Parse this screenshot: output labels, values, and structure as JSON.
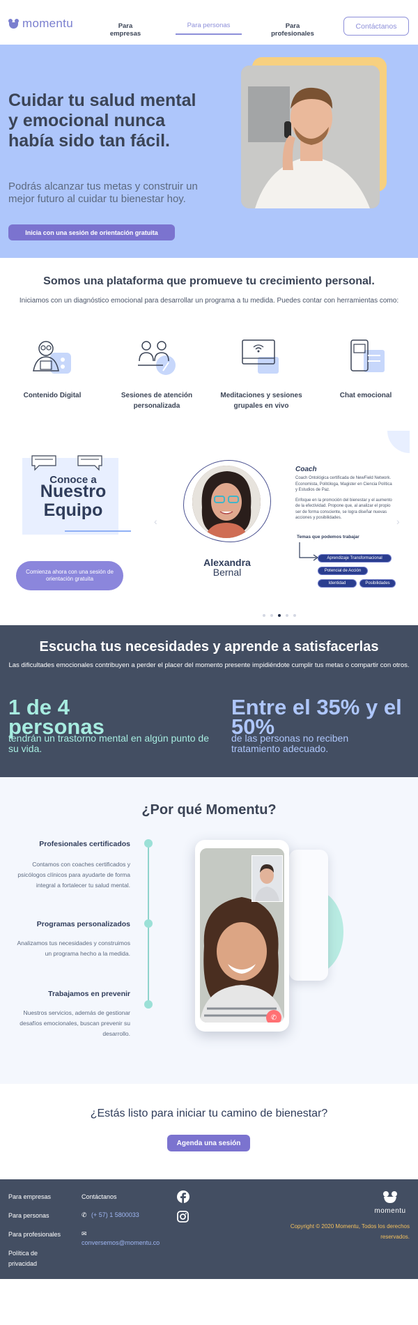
{
  "nav": {
    "logo_text": "momentu",
    "links": [
      {
        "line1": "Para",
        "line2": "empresas"
      },
      {
        "line1": "Para personas",
        "line2": ""
      },
      {
        "line1": "Para",
        "line2": "profesionales"
      }
    ],
    "contact_label": "Contáctanos"
  },
  "hero": {
    "title": "Cuidar tu salud mental y emocional nunca había sido tan fácil.",
    "subtitle": "Podrás alcanzar tus metas y construir un mejor futuro al cuidar tu bienestar hoy.",
    "button_label": "Inicia con una sesión de orientación gratuita"
  },
  "platform": {
    "title": "Somos una plataforma que promueve tu crecimiento personal.",
    "text": "Iniciamos con un diagnóstico emocional para desarrollar un programa a tu medida. Puedes contar con herramientas como:",
    "features": [
      {
        "label": "Contenido Digital",
        "icon": "digital-content-icon"
      },
      {
        "label": "Sesiones de atención personalizada",
        "icon": "personal-session-icon"
      },
      {
        "label": "Meditaciones y sesiones grupales en vivo",
        "icon": "live-meditation-icon"
      },
      {
        "label": "Chat emocional",
        "icon": "chat-icon"
      }
    ]
  },
  "team": {
    "conoce_line1": "Conoce a",
    "conoce_line2": "Nuestro",
    "conoce_line3": "Equipo",
    "button_label": "Comienza ahora con una sesión de orientación gratuita",
    "person_first": "Alexandra",
    "person_last": "Bernal",
    "coach_title": "Coach",
    "coach_bio": "Coach Ontológica certificada de NewField Network. Economista, Politóloga, Magister en Ciencia Política y Estudios de Paz.",
    "coach_focus": "Enfoque en la promoción del bienestar y el aumento de la efectividad. Propone que, al analizar el propio ser de forma consciente, se logra diseñar nuevas acciones y posibilidades.",
    "themes_title": "Temas que podemos trabajar",
    "themes": [
      "Aprendizaje Transformacional",
      "Potencial de Acción",
      "Identidad",
      "Posibilidades"
    ],
    "carousel_dots": 5,
    "active_dot": 3
  },
  "stats": {
    "title": "Escucha tus necesidades y aprende a satisfacerlas",
    "text": "Las dificultades emocionales contribuyen a perder el placer del momento presente impidiéndote cumplir tus metas o compartir con otros.",
    "stat1_big": "1 de 4 personas",
    "stat1_desc": "tendrán un trastorno mental en algún punto de su vida.",
    "stat2_big": "Entre el 35% y el 50%",
    "stat2_desc": "de las personas no reciben tratamiento adecuado.",
    "colors": {
      "stat1": "#a7ece0",
      "stat2": "#aec6fb"
    }
  },
  "why": {
    "title": "¿Por qué Momentu?",
    "items": [
      {
        "heading": "Profesionales certificados",
        "text": "Contamos con coaches certificados y psicólogos clínicos para ayudarte de forma integral a fortalecer tu salud mental."
      },
      {
        "heading": "Programas personalizados",
        "text": "Analizamos tus necesidades y construimos un programa hecho a la medida."
      },
      {
        "heading": "Trabajamos en prevenir",
        "text": "Nuestros servicios, además de gestionar desafíos emocionales, buscan prevenir su desarrollo."
      }
    ]
  },
  "cta": {
    "title": "¿Estás listo para iniciar tu camino de bienestar?",
    "button_label": "Agenda una sesión"
  },
  "footer": {
    "col1": [
      "Para empresas",
      "Para personas",
      "Para profesionales",
      "Política de privacidad"
    ],
    "contact_title": "Contáctanos",
    "phone": "(+ 57) 1 5800033",
    "email": "conversemos@momentu.co",
    "logo_text": "momentu",
    "copyright": "Copyright © 2020 Momentu, Todos los derechos reservados."
  },
  "colors": {
    "brand": "#7b73cf",
    "hero_bg": "#aec6fb",
    "dark_bg": "#434e62",
    "accent_yellow": "#f7d080"
  }
}
